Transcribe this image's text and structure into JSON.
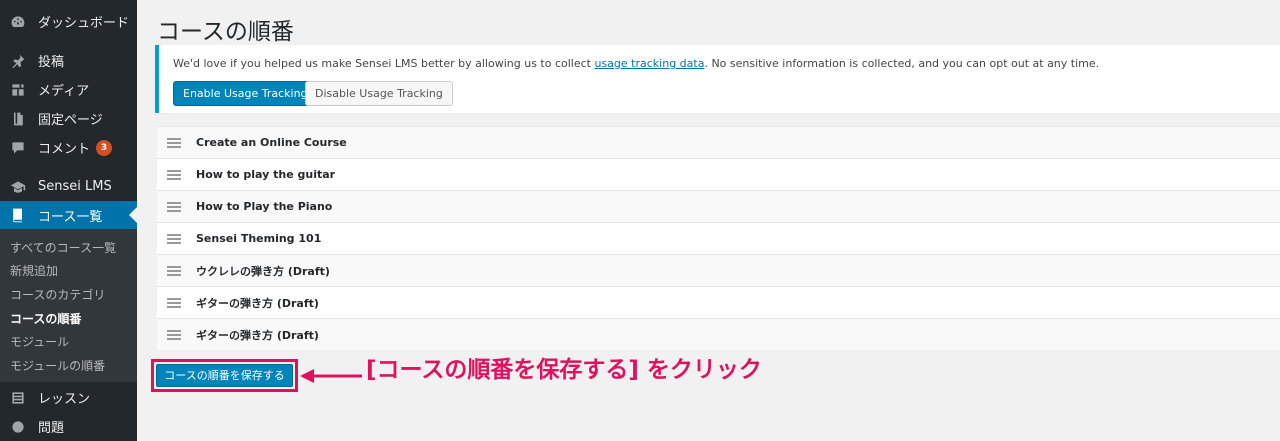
{
  "sidebar": {
    "items": [
      {
        "label": "ダッシュボード",
        "icon": "dashboard-icon"
      },
      {
        "label": "投稿",
        "icon": "pin-icon"
      },
      {
        "label": "メディア",
        "icon": "media-icon"
      },
      {
        "label": "固定ページ",
        "icon": "page-icon"
      },
      {
        "label": "コメント",
        "icon": "comment-icon",
        "badge": "3"
      },
      {
        "label": "Sensei LMS",
        "icon": "graduation-cap-icon"
      },
      {
        "label": "コース一覧",
        "icon": "book-icon"
      },
      {
        "label": "レッスン",
        "icon": "list-icon"
      },
      {
        "label": "問題",
        "icon": "question-icon"
      }
    ],
    "submenu": [
      {
        "label": "すべてのコース一覧"
      },
      {
        "label": "新規追加"
      },
      {
        "label": "コースのカテゴリ"
      },
      {
        "label": "コースの順番"
      },
      {
        "label": "モジュール"
      },
      {
        "label": "モジュールの順番"
      }
    ]
  },
  "main": {
    "title": "コースの順番",
    "notice": {
      "text_before": "We'd love if you helped us make Sensei LMS better by allowing us to collect ",
      "link": "usage tracking data",
      "text_after": ". No sensitive information is collected, and you can opt out at any time.",
      "enable_label": "Enable Usage Tracking",
      "disable_label": "Disable Usage Tracking"
    },
    "courses": [
      "Create an Online Course",
      "How to play the guitar",
      "How to Play the Piano",
      "Sensei Theming 101",
      "ウクレレの弾き方 (Draft)",
      "ギターの弾き方 (Draft)",
      "ギターの弾き方 (Draft)"
    ],
    "save_label": "コースの順番を保存する"
  },
  "annotation": {
    "text": "[コースの順番を保存する] をクリック",
    "color": "#e0125e"
  },
  "colors": {
    "sidebar_bg": "#23282d",
    "accent": "#0073aa",
    "notice_border": "#00a0d2"
  }
}
